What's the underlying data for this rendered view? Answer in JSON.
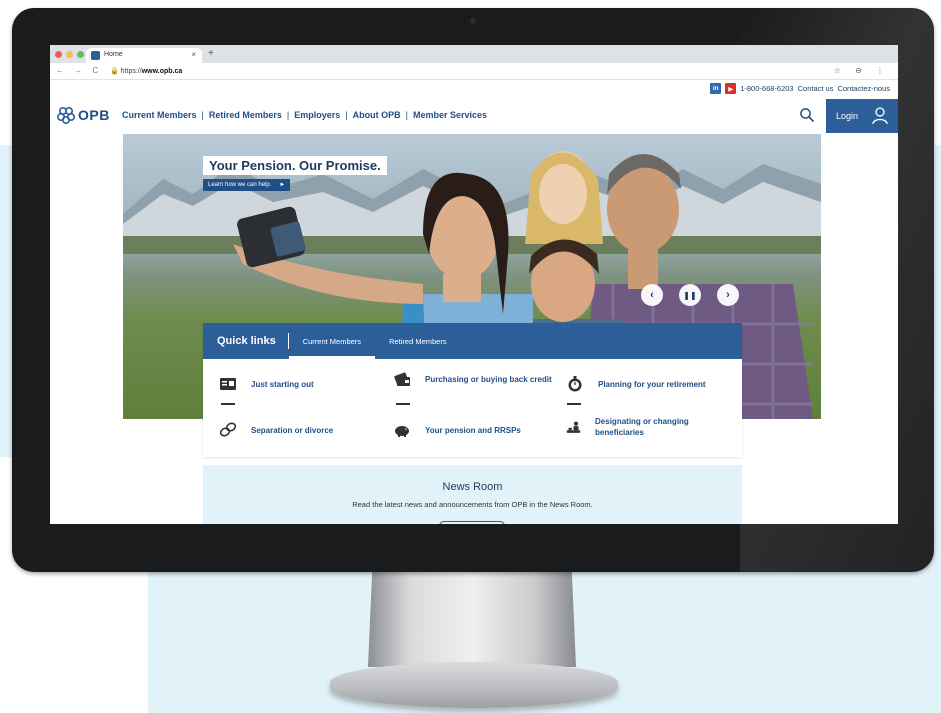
{
  "browser": {
    "tab_title": "Home",
    "tab_close": "×",
    "new_tab": "+",
    "nav_buttons": "← → C",
    "url_prefix": "https://",
    "url_host": "www.opb.ca",
    "right_icons": "☆ ⊖ ⋮"
  },
  "utility": {
    "linkedin": "in",
    "youtube": "▶",
    "phone": "1-800-668-6203",
    "contact_us": "Contact us",
    "contactez": "Contactez-nous"
  },
  "header": {
    "logo_text": "OPB",
    "nav": [
      "Current Members",
      "Retired Members",
      "Employers",
      "About OPB",
      "Member Services"
    ],
    "login": "Login"
  },
  "hero": {
    "title": "Your Pension. Our Promise.",
    "cta": "Learn how we can help.",
    "cta_arrow": "►",
    "prev": "‹",
    "pause": "❚❚",
    "next": "›"
  },
  "quick_links": {
    "title": "Quick links",
    "tabs": [
      "Current Members",
      "Retired Members"
    ],
    "items": [
      {
        "label": "Just starting out",
        "icon": "id-card-icon"
      },
      {
        "label": "Purchasing or buying back credit",
        "icon": "wallet-icon"
      },
      {
        "label": "Planning for your retirement",
        "icon": "stopwatch-icon"
      },
      {
        "label": "Separation or divorce",
        "icon": "rings-icon"
      },
      {
        "label": "Your pension and RRSPs",
        "icon": "piggy-bank-icon"
      },
      {
        "label": "Designating or changing beneficiaries",
        "icon": "beneficiary-icon"
      }
    ]
  },
  "news_room": {
    "title": "News Room",
    "text": "Read the latest news and announcements from OPB in the News Room."
  },
  "colors": {
    "brand_blue": "#2c5f99",
    "nav_text": "#1f4f86",
    "light_panel": "#e1f2f8"
  }
}
